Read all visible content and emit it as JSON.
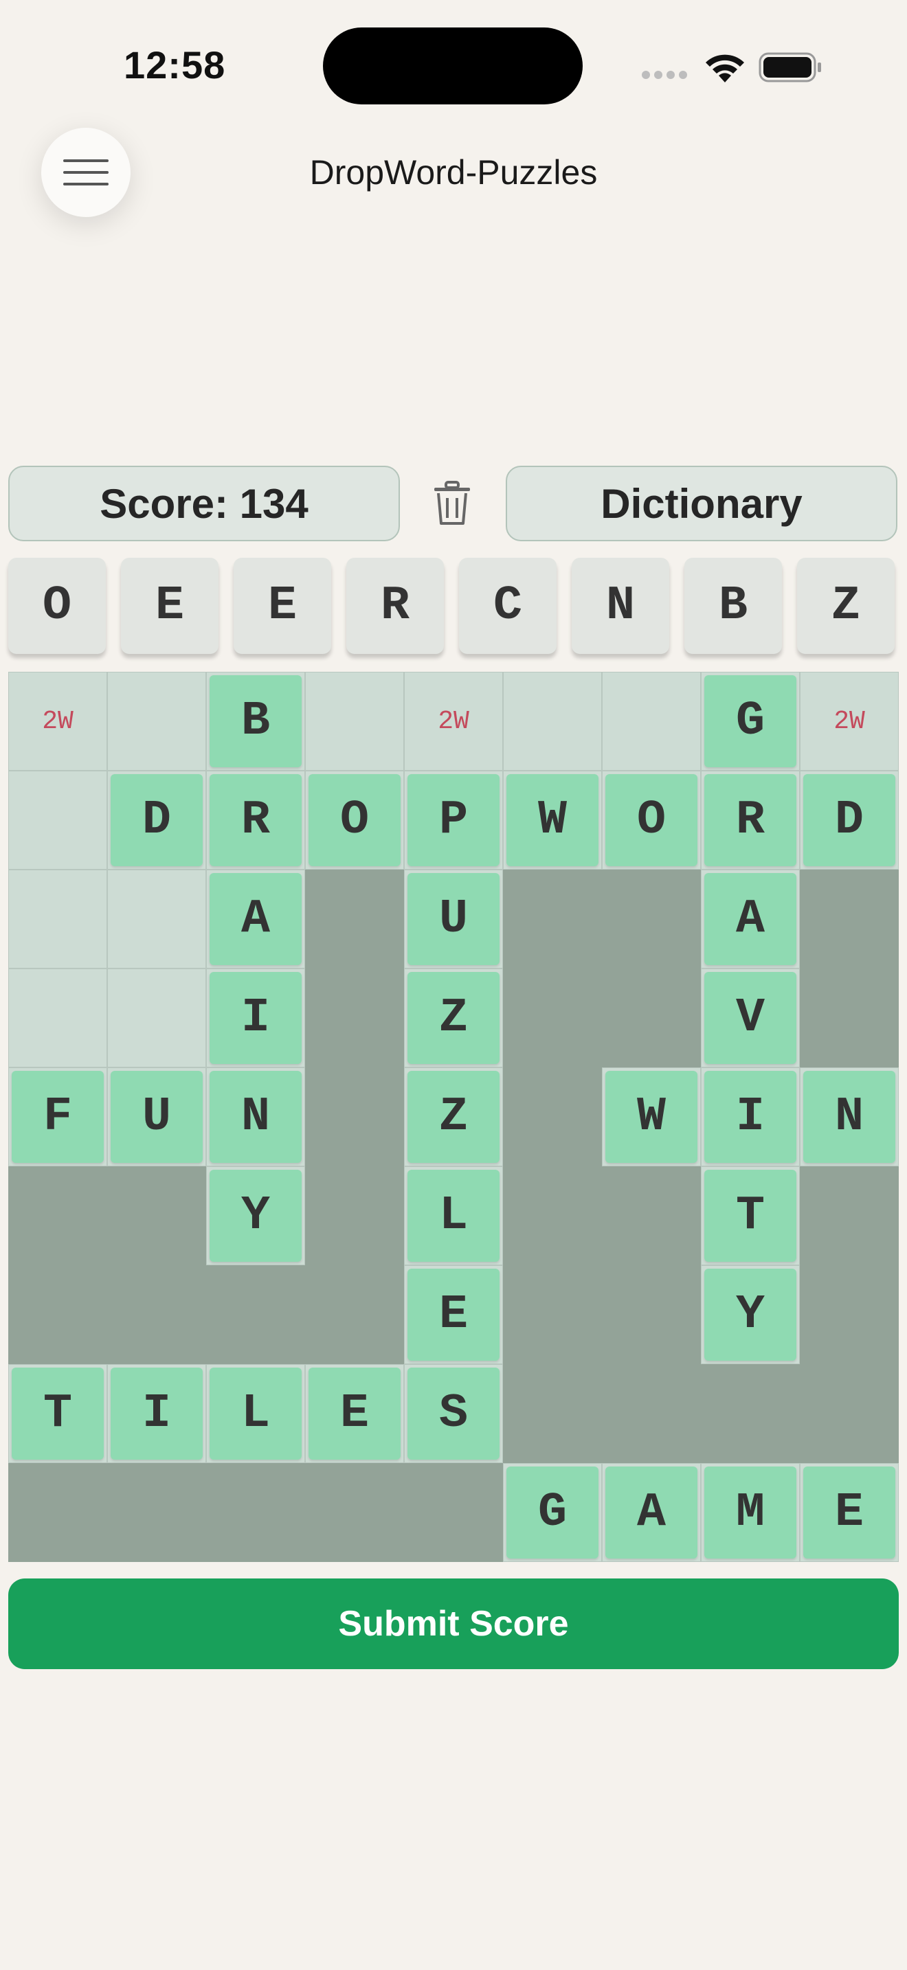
{
  "status_bar": {
    "time": "12:58"
  },
  "header": {
    "title": "DropWord-Puzzles",
    "menu_icon": "hamburger-menu-icon"
  },
  "toolbar": {
    "score_label": "Score: 134",
    "trash_icon": "trash-icon",
    "dictionary_label": "Dictionary"
  },
  "rack": [
    "O",
    "E",
    "E",
    "R",
    "C",
    "N",
    "B",
    "Z"
  ],
  "board": {
    "size": 9,
    "rows": [
      [
        "#2W",
        "#",
        "B",
        "#",
        "#2W",
        "#",
        "#",
        "G",
        "#2W"
      ],
      [
        "#",
        "D",
        "R",
        "O",
        "P",
        "W",
        "O",
        "R",
        "D"
      ],
      [
        "#",
        "#",
        "A",
        "x",
        "U",
        "x",
        "x",
        "A",
        "x"
      ],
      [
        "#",
        "#",
        "I",
        "x",
        "Z",
        "x",
        "x",
        "V",
        "x"
      ],
      [
        "F",
        "U",
        "N",
        "x",
        "Z",
        "x",
        "W",
        "I",
        "N"
      ],
      [
        "x",
        "x",
        "Y",
        "x",
        "L",
        "x",
        "x",
        "T",
        "x"
      ],
      [
        "x",
        "x",
        "x",
        "x",
        "E",
        "x",
        "x",
        "Y",
        "x"
      ],
      [
        "T",
        "I",
        "L",
        "E",
        "S",
        "x",
        "x",
        "x",
        "x"
      ],
      [
        "x",
        "x",
        "x",
        "x",
        "x",
        "G",
        "A",
        "M",
        "E"
      ]
    ]
  },
  "submit": {
    "label": "Submit Score"
  },
  "colors": {
    "background": "#f5f2ed",
    "tile": "#8fdab2",
    "empty_cell": "#cddcd4",
    "blocked_cell": "#93a398",
    "bonus_text": "#c44a5c",
    "submit": "#18a05a"
  }
}
